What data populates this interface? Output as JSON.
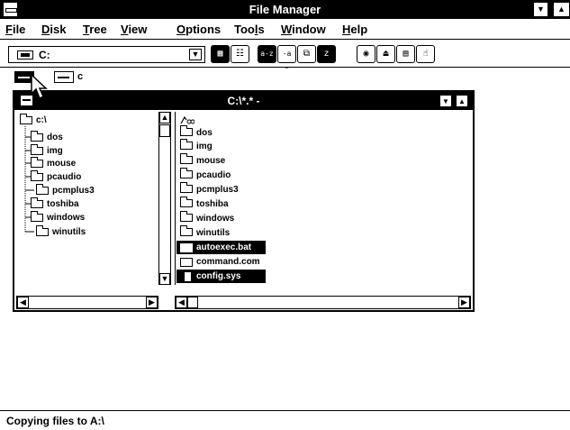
{
  "window": {
    "title": "File Manager",
    "minimize_glyph": "▼",
    "maximize_glyph": "▲"
  },
  "menu": [
    {
      "label": "File",
      "mnemonic": "F",
      "rest": "ile"
    },
    {
      "label": "Disk",
      "mnemonic": "D",
      "rest": "isk"
    },
    {
      "label": "Tree",
      "mnemonic": "T",
      "rest": "ree"
    },
    {
      "label": "View",
      "mnemonic": "V",
      "rest": "iew"
    },
    {
      "label": "Options",
      "mnemonic": "O",
      "rest": "ptions"
    },
    {
      "label": "Tools",
      "pre": "Too",
      "mnemonic": "l",
      "rest": "s"
    },
    {
      "label": "Window",
      "mnemonic": "W",
      "rest": "indow"
    },
    {
      "label": "Help",
      "mnemonic": "H",
      "rest": "elp"
    }
  ],
  "toolbar": {
    "drive_value": "C:",
    "drive_icon": "hard-drive-icon",
    "dropdown_glyph": "▼",
    "buttons": [
      {
        "name": "large-icons-view-icon",
        "glyph": "▦"
      },
      {
        "name": "list-view-icon",
        "glyph": "☷"
      },
      {
        "name": "sort-by-name-icon",
        "glyph": "a-z"
      },
      {
        "name": "sort-by-type-icon",
        "glyph": "-a z"
      },
      {
        "name": "copy-icon",
        "glyph": "⧉"
      },
      {
        "name": "compress-icon",
        "glyph": "z"
      },
      {
        "name": "connect-network-drive-icon",
        "glyph": "◉"
      },
      {
        "name": "disconnect-network-drive-icon",
        "glyph": "⏏"
      },
      {
        "name": "share-icon",
        "glyph": "▤"
      },
      {
        "name": "stop-sharing-icon",
        "glyph": "☝"
      }
    ]
  },
  "drives": [
    {
      "label": "",
      "icon": "floppy-drive-a-icon",
      "active": true
    },
    {
      "label": "c",
      "icon": "hard-drive-c-icon",
      "active": false
    }
  ],
  "child_window": {
    "title": "C:\\*.* -",
    "tree": [
      {
        "label": "c:\\",
        "level": 0
      },
      {
        "label": "dos",
        "level": 1
      },
      {
        "label": "img",
        "level": 1
      },
      {
        "label": "mouse",
        "level": 1
      },
      {
        "label": "pcaudio",
        "level": 1
      },
      {
        "label": "pcmplus3",
        "level": 1
      },
      {
        "label": "toshiba",
        "level": 1
      },
      {
        "label": "windows",
        "level": 1
      },
      {
        "label": "winutils",
        "level": 1
      }
    ],
    "up_dir_icon": "up-directory-icon",
    "files": [
      {
        "label": "dos",
        "type": "folder",
        "selected": false
      },
      {
        "label": "img",
        "type": "folder",
        "selected": false
      },
      {
        "label": "mouse",
        "type": "folder",
        "selected": false
      },
      {
        "label": "pcaudio",
        "type": "folder",
        "selected": false
      },
      {
        "label": "pcmplus3",
        "type": "folder",
        "selected": false
      },
      {
        "label": "toshiba",
        "type": "folder",
        "selected": false
      },
      {
        "label": "windows",
        "type": "folder",
        "selected": false
      },
      {
        "label": "winutils",
        "type": "folder",
        "selected": false
      },
      {
        "label": "autoexec.bat",
        "type": "program",
        "selected": true
      },
      {
        "label": "command.com",
        "type": "program",
        "selected": false
      },
      {
        "label": "config.sys",
        "type": "document",
        "selected": true
      }
    ]
  },
  "status": {
    "text": "Copying files to A:\\"
  }
}
